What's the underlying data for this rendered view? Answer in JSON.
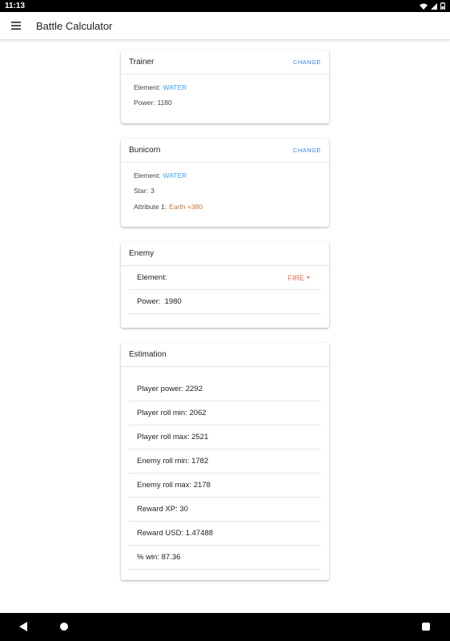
{
  "status": {
    "time": "11:13"
  },
  "app": {
    "title": "Battle Calculator"
  },
  "trainer": {
    "title": "Trainer",
    "change_label": "CHANGE",
    "element_label": "Element:",
    "element_value": "WATER",
    "power_label": "Power:",
    "power_value": "1180"
  },
  "bunicorn": {
    "title": "Bunicorn",
    "change_label": "CHANGE",
    "element_label": "Element:",
    "element_value": "WATER",
    "star_label": "Star:",
    "star_value": "3",
    "attr_label": "Attribute 1:",
    "attr_value": "Earth +380"
  },
  "enemy": {
    "title": "Enemy",
    "element_label": "Element:",
    "element_value": "FIRE",
    "power_label": "Power:",
    "power_value": "1980"
  },
  "estimation": {
    "title": "Estimation",
    "rows": [
      "Player power: 2292",
      "Player roll min: 2062",
      "Player roll max: 2521",
      "Enemy roll min: 1782",
      "Enemy roll max: 2178",
      "Reward XP: 30",
      "Reward USD: 1.47488",
      "% win: 87.36"
    ]
  },
  "colors": {
    "accent": "#3b82f6",
    "water": "#3aa0ff",
    "fire": "#f06a4f",
    "earth": "#c7773a"
  }
}
